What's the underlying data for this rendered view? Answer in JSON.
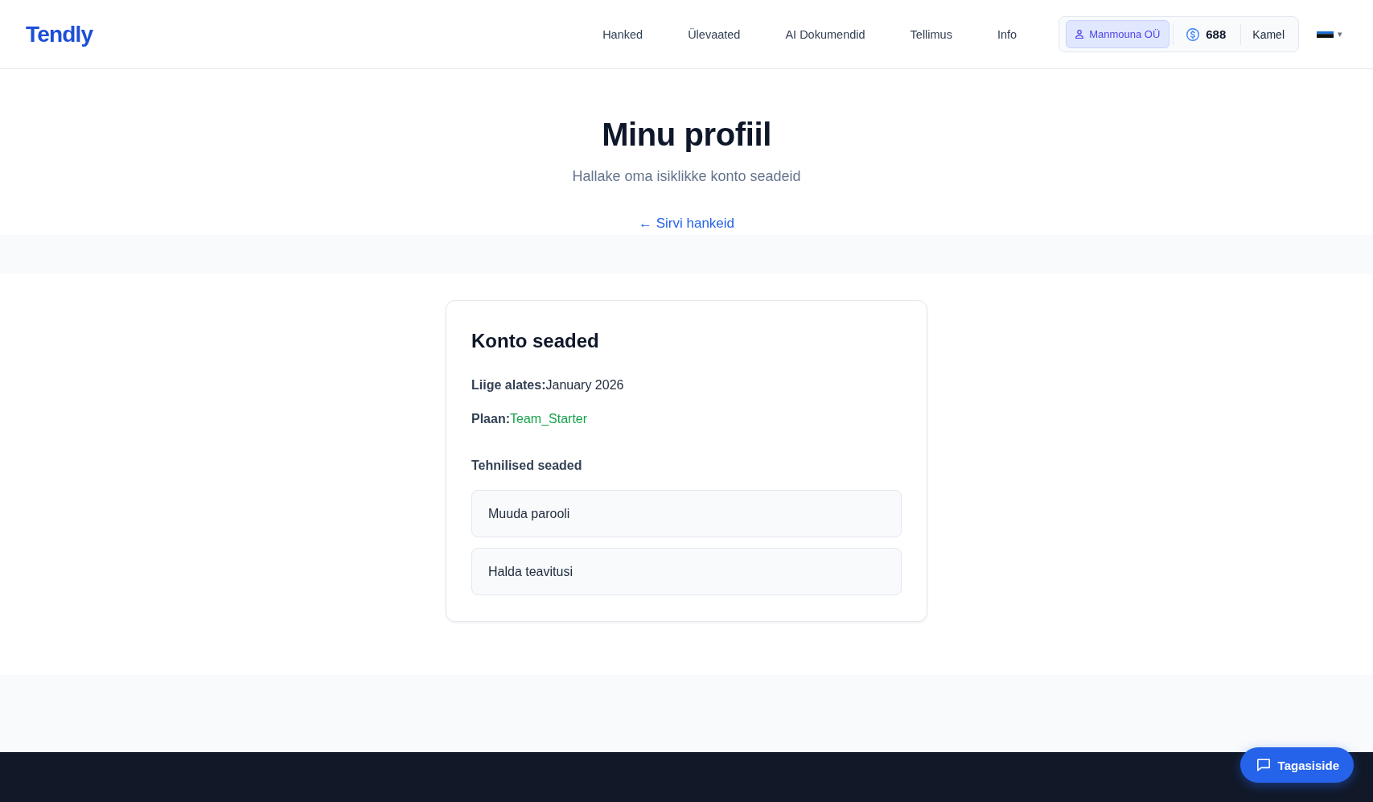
{
  "header": {
    "logo": "Tendly",
    "nav": [
      {
        "label": "Hanked"
      },
      {
        "label": "Ülevaated"
      },
      {
        "label": "AI Dokumendid"
      },
      {
        "label": "Tellimus"
      },
      {
        "label": "Info"
      }
    ],
    "account": {
      "company": "Manmouna OÜ",
      "credits": "688",
      "user": "Kamel"
    },
    "language": {
      "caret": "▾"
    }
  },
  "hero": {
    "title": "Minu profiil",
    "subtitle": "Hallake oma isiklikke konto seadeid",
    "back_link": "← Sirvi hankeid"
  },
  "settings_card": {
    "title": "Konto seaded",
    "details": [
      {
        "kind": "text",
        "label": "Liige alates:",
        "value": "January 2026"
      },
      {
        "kind": "plan",
        "label": "Plaan:",
        "value": "Team_Starter"
      }
    ],
    "section_title": "Tehnilised seaded",
    "actions": [
      {
        "label": "Muuda parooli"
      },
      {
        "label": "Halda teavitusi"
      }
    ]
  },
  "feedback_button": {
    "label": "Tagasiside"
  }
}
